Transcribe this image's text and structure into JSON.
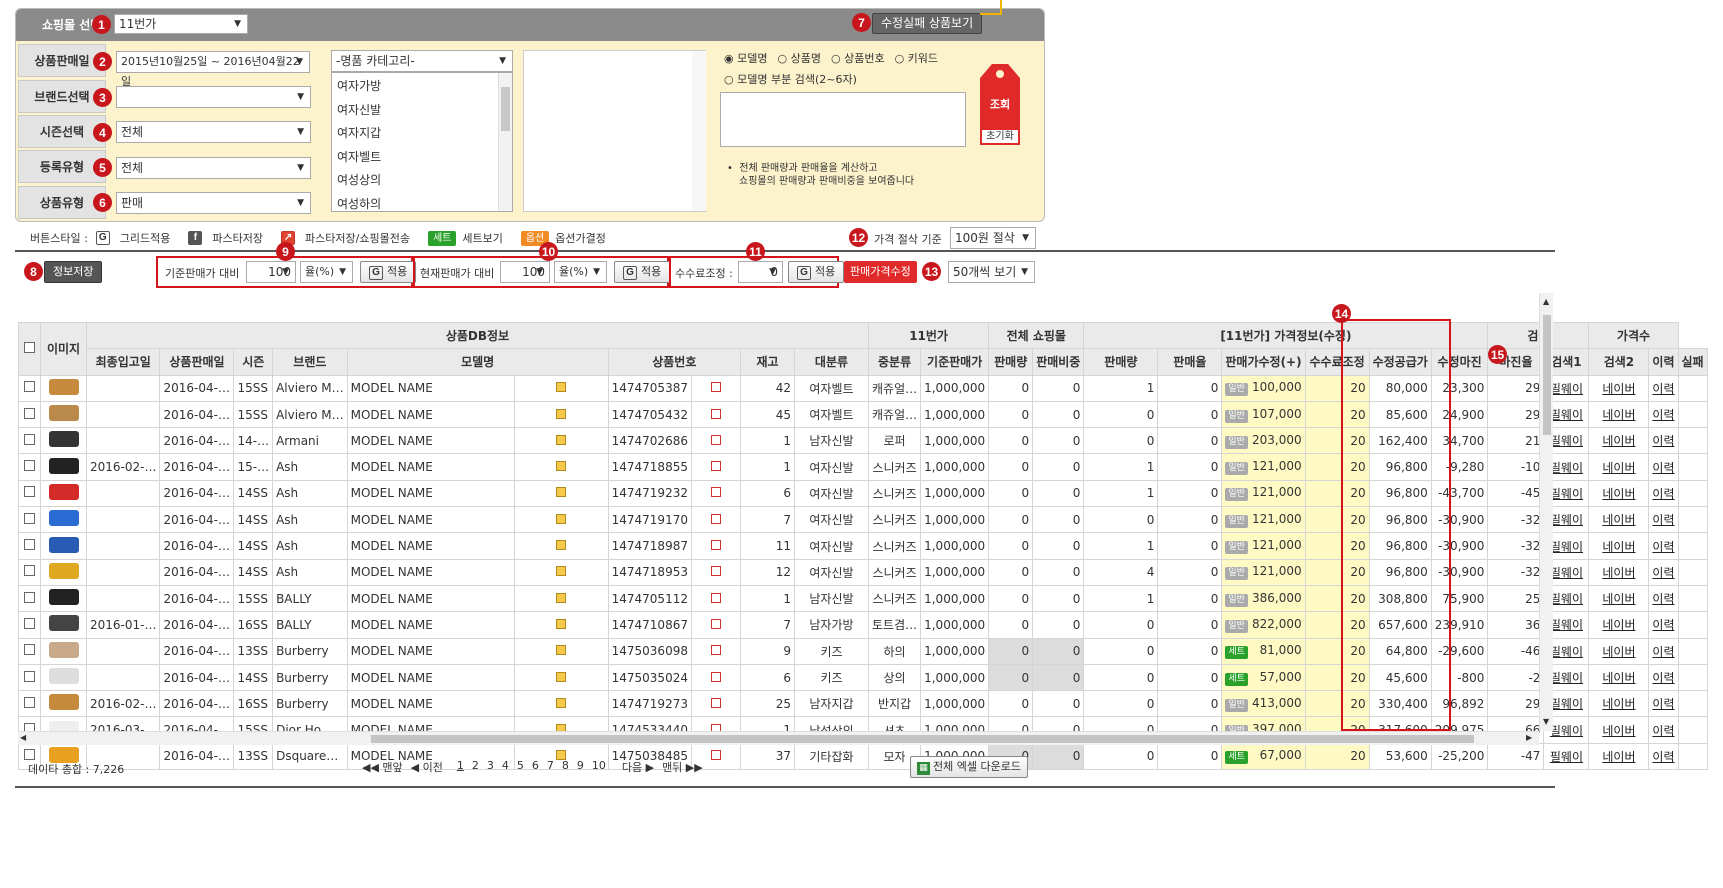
{
  "filter": {
    "shop_label": "쇼핑몰 선택",
    "shop_value": "11번가",
    "date_label": "상품판매일",
    "date_value": "2015년10월25일 ~ 2016년04월22일",
    "brand_label": "브랜드선택",
    "season_label": "시즌선택",
    "season_value": "전체",
    "reg_label": "등록유형",
    "reg_value": "전체",
    "ptype_label": "상품유형",
    "ptype_value": "판매",
    "category_header": "-명품 카테고리-",
    "categories": [
      "여자가방",
      "여자신발",
      "여자지갑",
      "여자벨트",
      "여성상의",
      "여성하의"
    ],
    "radios": [
      "모델명",
      "상품명",
      "상품번호",
      "키워드"
    ],
    "partial": "모델명 부분 검색(2~6자)",
    "note1": "전체 판매량과 판매율을 계산하고",
    "note2": "쇼핑몰의 판매량과 판매비중을 보여줍니다",
    "search_btn": "조회",
    "reset_btn": "초기화",
    "fail_btn": "수정실패 상품보기"
  },
  "style_bar": {
    "label": "버튼스타일 :",
    "items": [
      {
        "icon": "G",
        "text": "그리드적용"
      },
      {
        "icon": "f",
        "text": "파스타저장"
      },
      {
        "icon": "↗",
        "text": "파스타저장/쇼핑몰전송"
      },
      {
        "icon": "세트",
        "text": "세트보기"
      },
      {
        "icon": "옵션",
        "text": "옵션가결정"
      }
    ],
    "price_cut_label": "가격 절삭 기준",
    "price_cut_value": "100원 절삭"
  },
  "toolbar": {
    "save": "정보저장",
    "base_label": "기준판매가 대비",
    "base_value": "100",
    "base_unit": "율(%)",
    "apply": "적용",
    "cur_label": "현재판매가 대비",
    "cur_value": "100",
    "cur_unit": "율(%)",
    "fee_label": "수수료조정 :",
    "fee_value": "0",
    "price_edit": "판매가격수정",
    "view": "50개씩 보기"
  },
  "table": {
    "group1": "상품DB정보",
    "group2": "11번가",
    "group3": "전체 쇼핑몰",
    "group4": "[11번가] 가격정보(수정)",
    "group5": "검색",
    "group6": "가격수",
    "headers": [
      "이미지",
      "최종입고일",
      "상품판매일",
      "시즌",
      "브랜드",
      "모델명",
      "상품번호",
      "재고",
      "대분류",
      "중분류",
      "기준판매가",
      "판매량",
      "판매비중",
      "판매량",
      "판매율",
      "판매가수정(+)",
      "수수료조정",
      "수정공급가",
      "수정마진",
      "마진율",
      "검색1",
      "검색2",
      "이력",
      "실패"
    ],
    "rows": [
      [
        "",
        "2016-04-…",
        "15SS",
        "Alviero M…",
        "MODEL NAME",
        "1474705387",
        "42",
        "여자벨트",
        "캐쥬얼…",
        "1,000,000",
        "0",
        "0",
        "1",
        "0",
        "일반",
        "100,000",
        "20",
        "80,000",
        "23,300",
        "29"
      ],
      [
        "",
        "2016-04-…",
        "15SS",
        "Alviero M…",
        "MODEL NAME",
        "1474705432",
        "45",
        "여자벨트",
        "캐쥬얼…",
        "1,000,000",
        "0",
        "0",
        "0",
        "0",
        "일반",
        "107,000",
        "20",
        "85,600",
        "24,900",
        "29"
      ],
      [
        "",
        "2016-04-…",
        "14-…",
        "Armani",
        "MODEL NAME",
        "1474702686",
        "1",
        "남자신발",
        "로퍼",
        "1,000,000",
        "0",
        "0",
        "0",
        "0",
        "일반",
        "203,000",
        "20",
        "162,400",
        "34,700",
        "21"
      ],
      [
        "2016-02-…",
        "2016-04-…",
        "15-…",
        "Ash",
        "MODEL NAME",
        "1474718855",
        "1",
        "여자신발",
        "스니커즈",
        "1,000,000",
        "0",
        "0",
        "1",
        "0",
        "일반",
        "121,000",
        "20",
        "96,800",
        "-9,280",
        "-10"
      ],
      [
        "",
        "2016-04-…",
        "14SS",
        "Ash",
        "MODEL NAME",
        "1474719232",
        "6",
        "여자신발",
        "스니커즈",
        "1,000,000",
        "0",
        "0",
        "1",
        "0",
        "일반",
        "121,000",
        "20",
        "96,800",
        "-43,700",
        "-45"
      ],
      [
        "",
        "2016-04-…",
        "14SS",
        "Ash",
        "MODEL NAME",
        "1474719170",
        "7",
        "여자신발",
        "스니커즈",
        "1,000,000",
        "0",
        "0",
        "0",
        "0",
        "일반",
        "121,000",
        "20",
        "96,800",
        "-30,900",
        "-32"
      ],
      [
        "",
        "2016-04-…",
        "14SS",
        "Ash",
        "MODEL NAME",
        "1474718987",
        "11",
        "여자신발",
        "스니커즈",
        "1,000,000",
        "0",
        "0",
        "1",
        "0",
        "일반",
        "121,000",
        "20",
        "96,800",
        "-30,900",
        "-32"
      ],
      [
        "",
        "2016-04-…",
        "14SS",
        "Ash",
        "MODEL NAME",
        "1474718953",
        "12",
        "여자신발",
        "스니커즈",
        "1,000,000",
        "0",
        "0",
        "4",
        "0",
        "일반",
        "121,000",
        "20",
        "96,800",
        "-30,900",
        "-32"
      ],
      [
        "",
        "2016-04-…",
        "15SS",
        "BALLY",
        "MODEL NAME",
        "1474705112",
        "1",
        "남자신발",
        "스니커즈",
        "1,000,000",
        "0",
        "0",
        "1",
        "0",
        "일반",
        "386,000",
        "20",
        "308,800",
        "75,900",
        "25"
      ],
      [
        "2016-01-…",
        "2016-04-…",
        "16SS",
        "BALLY",
        "MODEL NAME",
        "1474710867",
        "7",
        "남자가방",
        "토트겸…",
        "1,000,000",
        "0",
        "0",
        "0",
        "0",
        "일반",
        "822,000",
        "20",
        "657,600",
        "239,910",
        "36"
      ],
      [
        "",
        "2016-04-…",
        "13SS",
        "Burberry",
        "MODEL NAME",
        "1475036098",
        "9",
        "키즈",
        "하의",
        "1,000,000",
        "0",
        "0",
        "0",
        "0",
        "세트",
        "81,000",
        "20",
        "64,800",
        "-29,600",
        "-46"
      ],
      [
        "",
        "2016-04-…",
        "14SS",
        "Burberry",
        "MODEL NAME",
        "1475035024",
        "6",
        "키즈",
        "상의",
        "1,000,000",
        "0",
        "0",
        "0",
        "0",
        "세트",
        "57,000",
        "20",
        "45,600",
        "-800",
        "-2"
      ],
      [
        "2016-02-…",
        "2016-04-…",
        "16SS",
        "Burberry",
        "MODEL NAME",
        "1474719273",
        "25",
        "남자지갑",
        "반지갑",
        "1,000,000",
        "0",
        "0",
        "0",
        "0",
        "일반",
        "413,000",
        "20",
        "330,400",
        "96,892",
        "29"
      ],
      [
        "2016-03-…",
        "2016-04-…",
        "15SS",
        "Dior Ho…",
        "MODEL NAME",
        "1474533440",
        "1",
        "남성상의",
        "셔츠",
        "1,000,000",
        "0",
        "0",
        "0",
        "0",
        "일반",
        "397,000",
        "20",
        "317,600",
        "209,975",
        "66"
      ],
      [
        "",
        "2016-04-…",
        "13SS",
        "Dsquare…",
        "MODEL NAME",
        "1475038485",
        "37",
        "기타잡화",
        "모자",
        "1,000,000",
        "0",
        "0",
        "0",
        "0",
        "세트",
        "67,000",
        "20",
        "53,600",
        "-25,200",
        "-47"
      ]
    ],
    "search1": "필웨이",
    "search2": "네이버",
    "history": "이력"
  },
  "footer": {
    "total": "데이타 총합 : 7,226",
    "first": "◀◀ 맨앞",
    "prev": "◀ 이전",
    "pages": [
      "1",
      "2",
      "3",
      "4",
      "5",
      "6",
      "7",
      "8",
      "9",
      "10"
    ],
    "next": "다음 ▶",
    "last": "맨뒤 ▶▶",
    "excel": "전체 엑셀 다운로드"
  },
  "markers": [
    "1",
    "2",
    "3",
    "4",
    "5",
    "6",
    "7",
    "8",
    "9",
    "10",
    "11",
    "12",
    "13",
    "14",
    "15"
  ],
  "colors": {
    "accent": "#c8161d",
    "panel": "#fcf3cc",
    "header": "#8a8a8a"
  }
}
